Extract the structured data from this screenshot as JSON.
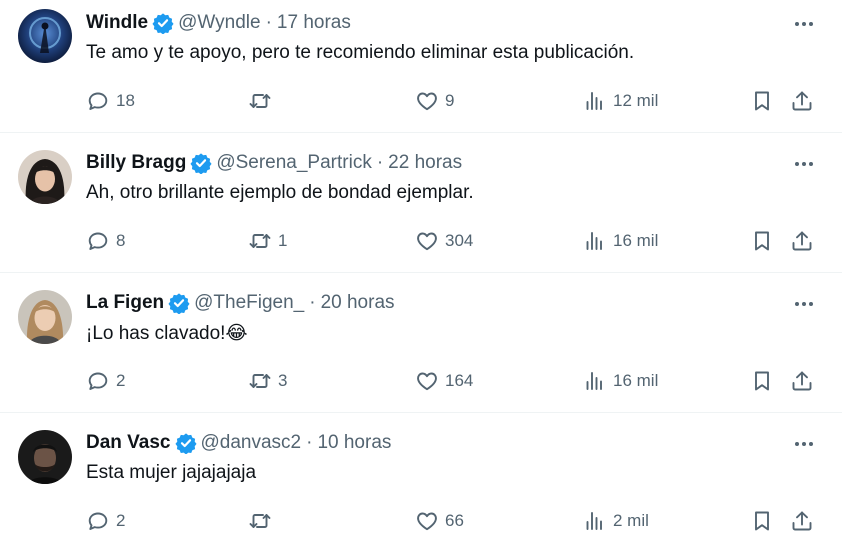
{
  "tweets": [
    {
      "name": "Windle",
      "handle": "@Wyndle",
      "sep": "·",
      "time": "17 horas",
      "text": "Te amo y te apoyo, pero te recomiendo eliminar esta publicación.",
      "replies": "18",
      "retweets": "",
      "likes": "9",
      "views": "12 mil"
    },
    {
      "name": "Billy Bragg",
      "handle": "@Serena_Partrick",
      "sep": "·",
      "time": "22 horas",
      "text": "Ah, otro brillante ejemplo de bondad ejemplar.",
      "replies": "8",
      "retweets": "1",
      "likes": "304",
      "views": "16 mil"
    },
    {
      "name": "La Figen",
      "handle": "@TheFigen_",
      "sep": "·",
      "time": "20 horas",
      "text": "¡Lo has clavado!😂",
      "replies": "2",
      "retweets": "3",
      "likes": "164",
      "views": "16 mil"
    },
    {
      "name": "Dan Vasc",
      "handle": "@danvasc2",
      "sep": "·",
      "time": "10 horas",
      "text": "Esta mujer jajajajaja",
      "replies": "2",
      "retweets": "",
      "likes": "66",
      "views": "2 mil"
    }
  ],
  "colors": {
    "text": "#0f1419",
    "secondary": "#536471",
    "verified": "#1d9bf0",
    "divider": "#eff3f4"
  },
  "icons": [
    "reply-icon",
    "retweet-icon",
    "like-icon",
    "views-icon",
    "bookmark-icon",
    "share-icon",
    "more-icon",
    "verified-badge-icon"
  ]
}
